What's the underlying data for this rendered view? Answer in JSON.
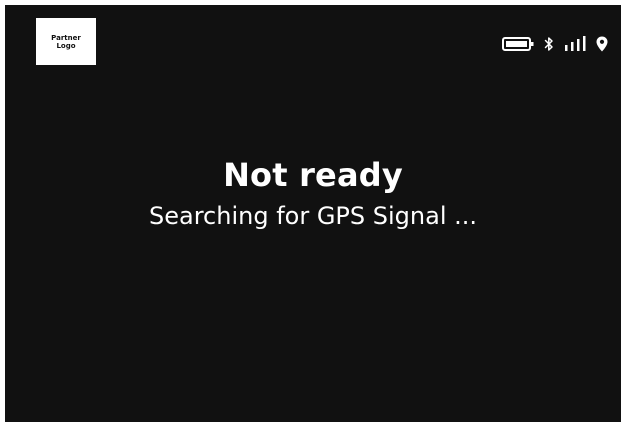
{
  "logo": {
    "text": "Partner\nLogo"
  },
  "status_bar": {
    "icons": [
      "battery-icon",
      "bluetooth-icon",
      "signal-icon",
      "location-pin-icon"
    ]
  },
  "status": {
    "title": "Not ready",
    "message": "Searching for GPS Signal ..."
  },
  "colors": {
    "background": "#111111",
    "text": "#ffffff"
  }
}
